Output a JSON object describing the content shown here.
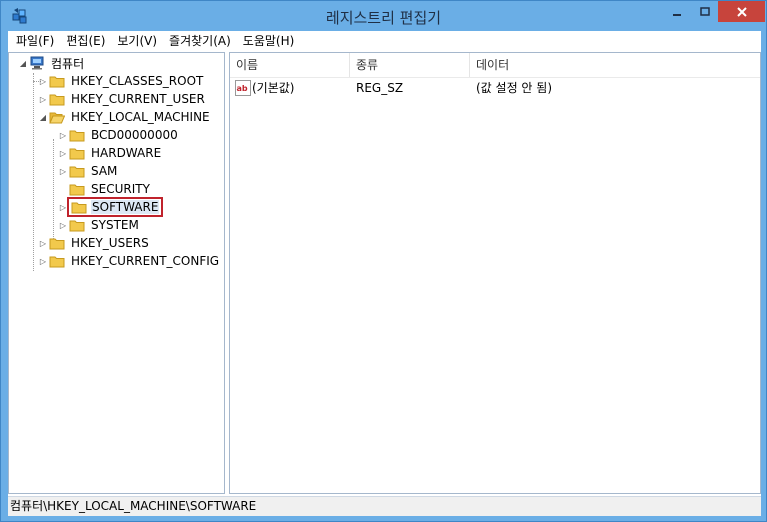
{
  "window": {
    "title": "레지스트리 편집기"
  },
  "menu": [
    "파일(F)",
    "편집(E)",
    "보기(V)",
    "즐겨찾기(A)",
    "도움말(H)"
  ],
  "tree": {
    "root": "컴퓨터",
    "hives": [
      {
        "label": "HKEY_CLASSES_ROOT"
      },
      {
        "label": "HKEY_CURRENT_USER"
      },
      {
        "label": "HKEY_LOCAL_MACHINE",
        "expanded": true,
        "children": [
          "BCD00000000",
          "HARDWARE",
          "SAM",
          "SECURITY",
          "SOFTWARE",
          "SYSTEM"
        ]
      },
      {
        "label": "HKEY_USERS"
      },
      {
        "label": "HKEY_CURRENT_CONFIG"
      }
    ],
    "selected": "SOFTWARE"
  },
  "list": {
    "columns": [
      "이름",
      "종류",
      "데이터"
    ],
    "rows": [
      {
        "name": "(기본값)",
        "type": "REG_SZ",
        "data": "(값 설정 안 됨)",
        "icon": "string-value-icon"
      }
    ]
  },
  "status": "컴퓨터\\HKEY_LOCAL_MACHINE\\SOFTWARE",
  "colors": {
    "titlebar": "#6aaee6",
    "close": "#c7443c",
    "highlight": "#c0232c",
    "folder": "#f2c94c"
  }
}
